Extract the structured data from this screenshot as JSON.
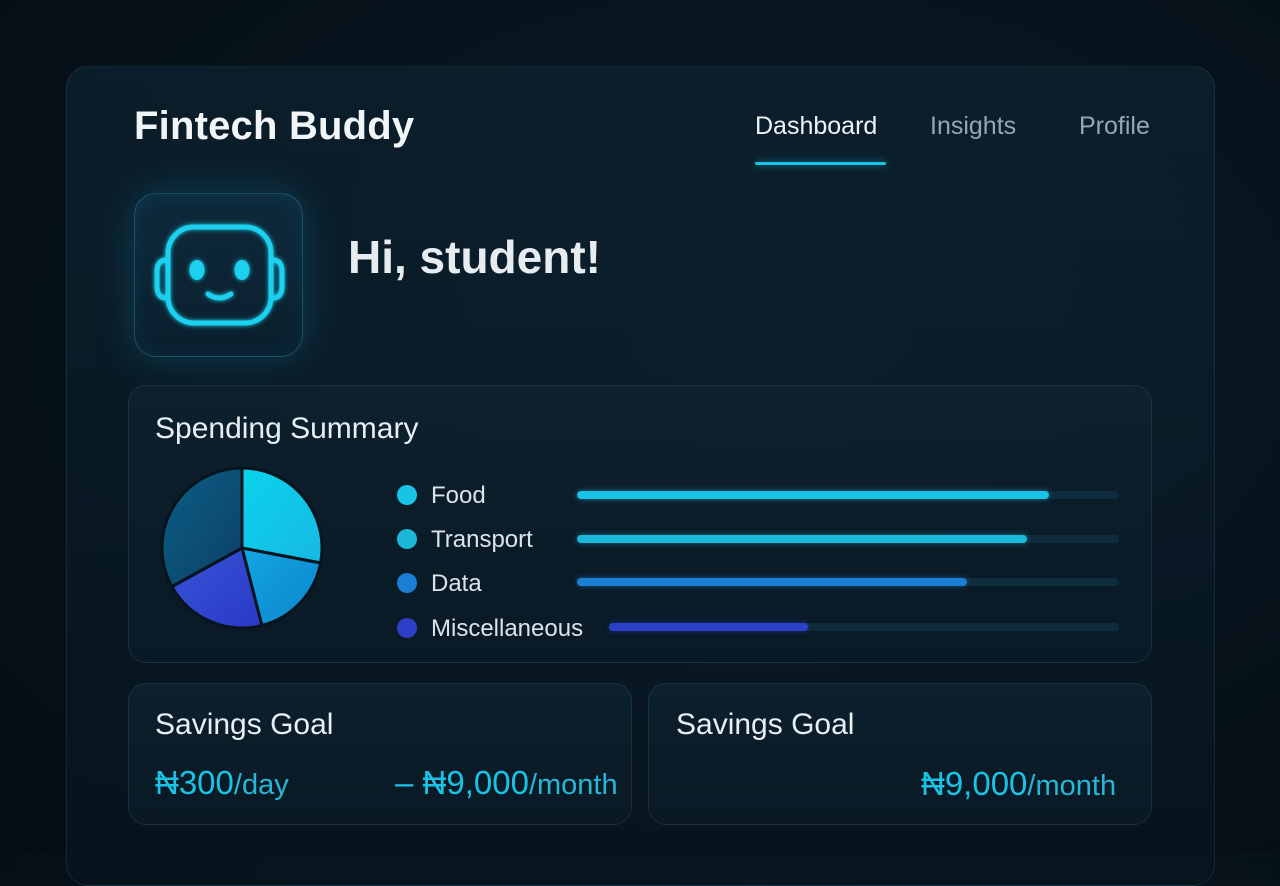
{
  "app": {
    "title": "Fintech Buddy"
  },
  "nav": {
    "tabs": [
      {
        "label": "Dashboard",
        "active": true
      },
      {
        "label": "Insights",
        "active": false
      },
      {
        "label": "Profile",
        "active": false
      }
    ]
  },
  "avatar": {
    "icon": "robot-face-icon"
  },
  "greeting": "Hi, student!",
  "spending": {
    "title": "Spending Summary",
    "categories": [
      {
        "label": "Food",
        "color": "#19c3e6",
        "level": 0.87
      },
      {
        "label": "Transport",
        "color": "#1bb8d9",
        "level": 0.83
      },
      {
        "label": "Data",
        "color": "#1a7fd4",
        "level": 0.72
      },
      {
        "label": "Miscellaneous",
        "color": "#2c3fc9",
        "level": 0.39
      }
    ],
    "pie_shares": [
      {
        "label": "Food",
        "share": 0.28,
        "color": "#19c9e6"
      },
      {
        "label": "Data",
        "share": 0.18,
        "color": "#0f8fd6"
      },
      {
        "label": "Miscellaneous",
        "share": 0.21,
        "color": "#3048d0"
      },
      {
        "label": "Transport",
        "share": 0.33,
        "color": "#0d5f8c"
      }
    ]
  },
  "savings_cards": [
    {
      "title": "Savings Goal",
      "daily_amount": "₦300",
      "daily_unit": "/day",
      "monthly_amount": "– ₦9,000",
      "monthly_unit": "/month"
    },
    {
      "title": "Savings Goal",
      "monthly_amount": "₦9,000",
      "monthly_unit": "/month"
    }
  ],
  "colors": {
    "accent": "#19c3e6",
    "background": "#07131c"
  }
}
